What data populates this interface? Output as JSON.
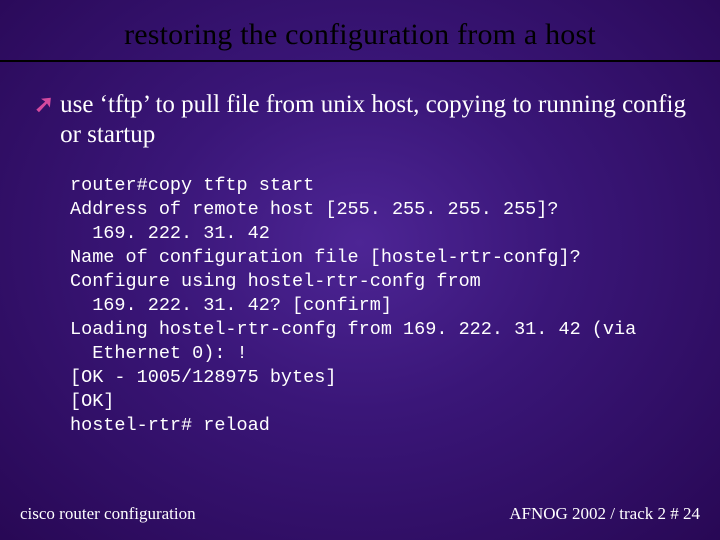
{
  "slide": {
    "title": "restoring the configuration from a host",
    "bullet": "use ‘tftp’ to pull file from unix host, copying to running config or startup",
    "terminal": "router#copy tftp start\nAddress of remote host [255. 255. 255. 255]?\n  169. 222. 31. 42\nName of configuration file [hostel-rtr-confg]?\nConfigure using hostel-rtr-confg from\n  169. 222. 31. 42? [confirm]\nLoading hostel-rtr-confg from 169. 222. 31. 42 (via\n  Ethernet 0): !\n[OK - 1005/128975 bytes]\n[OK]\nhostel-rtr# reload"
  },
  "footer": {
    "left": "cisco router configuration",
    "right": "AFNOG 2002 / track 2  # 24"
  }
}
